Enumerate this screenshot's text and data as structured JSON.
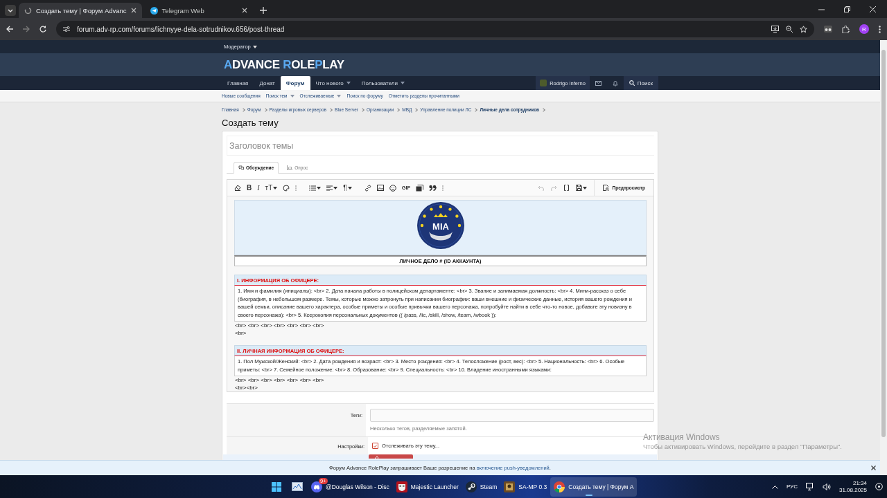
{
  "browser": {
    "tabs": [
      {
        "title": "Создать тему | Форум Advanc",
        "selected": true
      },
      {
        "title": "Telegram Web",
        "selected": false
      }
    ],
    "url": "forum.adv-rp.com/forums/lichnyye-dela-sotrudnikov.656/post-thread",
    "profile_initial": "R"
  },
  "forum": {
    "staff_menu": "Модератор",
    "logo": [
      {
        "text": "A",
        "accent": true
      },
      {
        "text": "DVANCE ",
        "accent": false
      },
      {
        "text": "R",
        "accent": true
      },
      {
        "text": "OLE",
        "accent": false
      },
      {
        "text": "P",
        "accent": true
      },
      {
        "text": "LAY",
        "accent": false
      }
    ],
    "nav": [
      {
        "label": "Главная",
        "selected": false,
        "dropdown": false
      },
      {
        "label": "Донат",
        "selected": false,
        "dropdown": false
      },
      {
        "label": "Форум",
        "selected": true,
        "dropdown": false
      },
      {
        "label": "Что нового",
        "selected": false,
        "dropdown": true
      },
      {
        "label": "Пользователи",
        "selected": false,
        "dropdown": true
      }
    ],
    "user": "Rodrigo Inferno",
    "search": "Поиск",
    "subnav": [
      {
        "label": "Новые сообщения",
        "dropdown": false
      },
      {
        "label": "Поиск тем",
        "dropdown": true
      },
      {
        "label": "Отслеживаемые",
        "dropdown": true
      },
      {
        "label": "Поиск по форуму",
        "dropdown": false
      },
      {
        "label": "Отметить разделы прочитанными",
        "dropdown": false
      }
    ],
    "breadcrumbs": [
      {
        "label": "Главная",
        "current": false
      },
      {
        "label": "Форум",
        "current": false
      },
      {
        "label": "Разделы игровых серверов",
        "current": false
      },
      {
        "label": "Blue Server",
        "current": false
      },
      {
        "label": "Организации",
        "current": false
      },
      {
        "label": "МВД",
        "current": false
      },
      {
        "label": "Управление полиции ЛС",
        "current": false
      },
      {
        "label": "Личные дела сотрудников",
        "current": true
      }
    ],
    "page_title": "Создать тему"
  },
  "form": {
    "title_placeholder": "Заголовок темы",
    "editor_tabs": [
      {
        "label": "Обсуждение",
        "selected": true
      },
      {
        "label": "Опрос",
        "selected": false
      }
    ],
    "toolbar": {
      "bold": "B",
      "italic": "I",
      "text_size": "тТ",
      "paragraph": "¶",
      "gif": "GIF"
    },
    "preview_button": "Предпросмотр",
    "post": {
      "emblem_text": "MIA",
      "caption": "ЛИЧНОЕ ДЕЛО # (ID АККАУНТА)",
      "sections": [
        {
          "heading": "I. ИНФОРМАЦИЯ ОБ ОФИЦЕРЕ:",
          "body": "1. Имя и фамилия (инициалы): <br> 2. Дата начала работы в полицейском департаменте: <br> 3. Звание и занимаемая должность: <br> 4. Мини-рассказ о себе (биография, в небольшом размере. Темы, которые можно затронуть при написании биографии: ваши внешние и физические данные, история вашего рождения и вашей семьи, описание вашего характера, особые приметы и особые привычки вашего персонажа, попробуйте найти в себе что-то новое, добавьте эту новизну в своего персонажа): <br> 5. Ксерокопия персональных документов (( /pass, /lic, /skill, /show, /team, /wbook )):",
          "after": [
            "<br> <br> <br> <br> <br> <br> <br>",
            "<br>"
          ]
        },
        {
          "heading": "II. ЛИЧНАЯ ИНФОРМАЦИЯ ОБ ОФИЦЕРЕ:",
          "body": "1. Пол Мужской/Женский: <br> 2. Дата рождения и возраст: <br> 3. Место рождения: <br> 4. Телосложение (рост, вес): <br> 5. Национальность: <br> 6. Особые приметы: <br> 7. Семейное положение: <br> 8. Образование: <br> 9. Специальность: <br> 10. Владение иностранными языками:",
          "after": [
            "<br> <br> <br> <br> <br> <br> <br>",
            "<br><br>"
          ]
        }
      ]
    },
    "tags_label": "Теги:",
    "tags_hint": "Несколько тегов, разделяемые запятой.",
    "settings_label": "Настройки:",
    "watch": {
      "label": "Отслеживать эту тему...",
      "checked": true
    }
  },
  "notice": {
    "text": "Форум Advance RolePlay запрашивает Ваше разрешение на ",
    "link": "включение push-уведомлений",
    "tail": "."
  },
  "activation": {
    "title": "Активация Windows",
    "text": "Чтобы активировать Windows, перейдите в раздел \"Параметры\"."
  },
  "taskbar": {
    "apps": [
      {
        "label": "@Douglas Wilson - Disc",
        "kind": "discord",
        "badge": "9+",
        "active": false
      },
      {
        "label": "Majestic Launcher",
        "kind": "majestic",
        "active": false
      },
      {
        "label": "Steam",
        "kind": "steam",
        "active": false
      },
      {
        "label": "SA-MP 0.3",
        "kind": "samp",
        "active": false
      },
      {
        "label": "Создать тему | Форум A",
        "kind": "chrome",
        "active": true
      }
    ],
    "language": "РУС",
    "time": "21:34",
    "date": "31.08.2025"
  }
}
